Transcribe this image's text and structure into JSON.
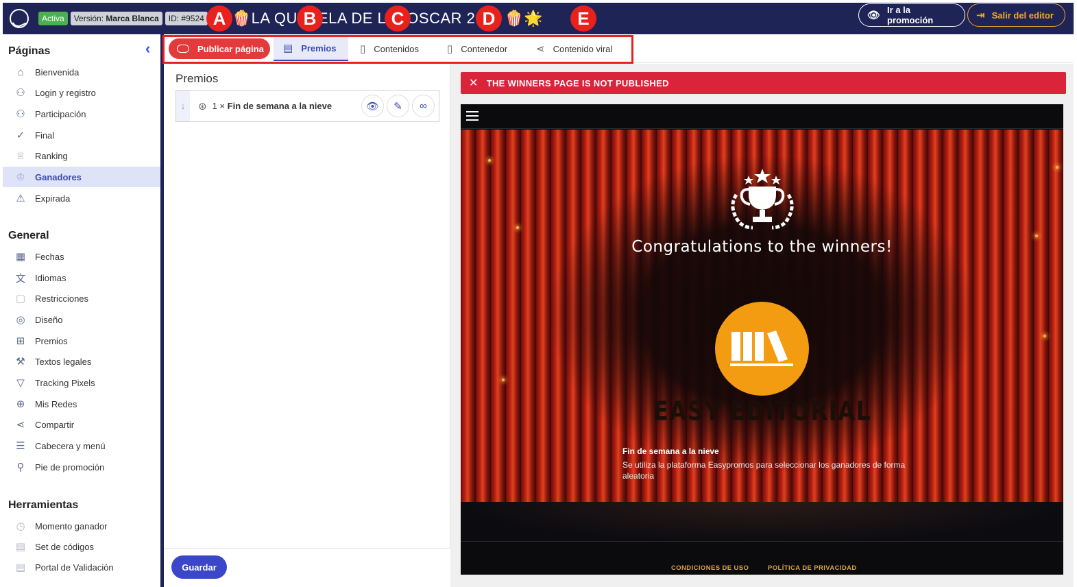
{
  "topbar": {
    "status_badge": "Activa",
    "version_prefix": "Versión:",
    "version_value": "Marca Blanca",
    "id_label": "ID: #9524",
    "promo_title_left": "🌟🍿LA QU",
    "promo_title_mid": "ELA DE L",
    "promo_title_mid2": "OSCAR 20",
    "promo_title_right": "🍿🌟",
    "goto_button": "Ir a la promoción",
    "exit_button": "Salir del editor"
  },
  "markers": [
    "A",
    "B",
    "C",
    "D",
    "E"
  ],
  "sidebar": {
    "section_pages": "Páginas",
    "pages": [
      {
        "label": "Bienvenida",
        "icon": "home-icon"
      },
      {
        "label": "Login y registro",
        "icon": "user-login-icon"
      },
      {
        "label": "Participación",
        "icon": "user-participation-icon"
      },
      {
        "label": "Final",
        "icon": "check-icon"
      },
      {
        "label": "Ranking",
        "icon": "ranking-icon"
      },
      {
        "label": "Ganadores",
        "icon": "trophy-icon",
        "selected": true
      },
      {
        "label": "Expirada",
        "icon": "warning-icon"
      }
    ],
    "section_general": "General",
    "general": [
      {
        "label": "Fechas",
        "icon": "calendar-icon"
      },
      {
        "label": "Idiomas",
        "icon": "translate-icon"
      },
      {
        "label": "Restricciones",
        "icon": "lock-icon"
      },
      {
        "label": "Diseño",
        "icon": "palette-icon"
      },
      {
        "label": "Premios",
        "icon": "gift-icon"
      },
      {
        "label": "Textos legales",
        "icon": "gavel-icon"
      },
      {
        "label": "Tracking Pixels",
        "icon": "funnel-icon"
      },
      {
        "label": "Mis Redes",
        "icon": "globe-icon"
      },
      {
        "label": "Compartir",
        "icon": "share-icon"
      },
      {
        "label": "Cabecera y menú",
        "icon": "menu-icon"
      },
      {
        "label": "Pie de promoción",
        "icon": "footer-icon"
      }
    ],
    "section_tools": "Herramientas",
    "tools": [
      {
        "label": "Momento ganador",
        "icon": "clock-icon"
      },
      {
        "label": "Set de códigos",
        "icon": "codes-icon"
      },
      {
        "label": "Portal de Validación",
        "icon": "portal-icon"
      }
    ]
  },
  "tabs": {
    "publish": "Publicar página",
    "items": [
      {
        "label": "Premios",
        "icon": "list-icon",
        "active": true
      },
      {
        "label": "Contenidos",
        "icon": "clipboard-icon"
      },
      {
        "label": "Contenedor",
        "icon": "document-icon"
      },
      {
        "label": "Contenido viral",
        "icon": "share-icon"
      }
    ]
  },
  "middle": {
    "title": "Premios",
    "prize_qty": "1 ×",
    "prize_name": "Fin de semana a la nieve",
    "save_button": "Guardar"
  },
  "preview": {
    "alert": "THE WINNERS PAGE IS NOT PUBLISHED",
    "congrats": "Congratulations to the winners!",
    "brand_name": "EASY EDITORIAL",
    "winner_title": "Fin de semana a la nieve",
    "winner_desc": "Se utiliza la plataforma Easypromos para seleccionar los ganadores de forma aleatoria",
    "footer_links": [
      "CONDICIONES DE USO",
      "POLÍTICA DE PRIVACIDAD"
    ]
  },
  "colors": {
    "navy": "#1f2457",
    "accent_blue": "#3b46c8",
    "alert_red": "#d9243a",
    "marker_red": "#e8211d",
    "exit_orange": "#f5a623",
    "brand_orange": "#f39c12"
  }
}
